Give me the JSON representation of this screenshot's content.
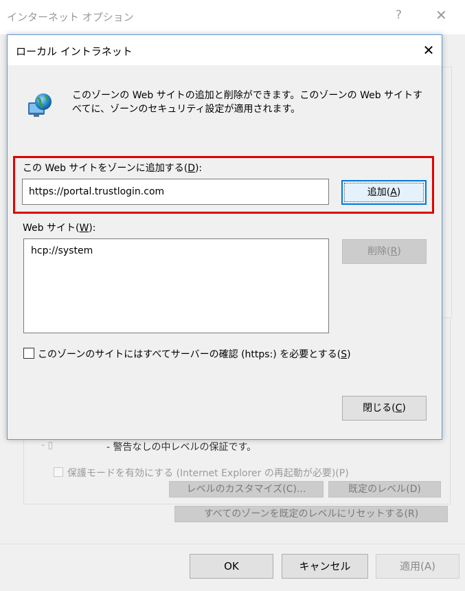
{
  "background_window": {
    "title": "インターネット オプション",
    "help_glyph": "?",
    "close_glyph": "✕",
    "security_level_mark": "- ▯",
    "security_level_text": "- 警告なしの中レベルの保証です。",
    "protected_mode_label": "保護モードを有効にする (Internet Explorer の再起動が必要)(P)",
    "custom_level_button": "レベルのカスタマイズ(C)...",
    "default_level_button": "既定のレベル(D)",
    "reset_all_button": "すべてのゾーンを既定のレベルにリセットする(R)",
    "ok_button": "OK",
    "cancel_button": "キャンセル",
    "apply_button": "適用(A)"
  },
  "dialog": {
    "title": "ローカル イントラネット",
    "close_glyph": "✕",
    "icon": "globe-monitor-icon",
    "info_text": "このゾーンの Web サイトの追加と削除ができます。このゾーンの Web サイトすべてに、ゾーンのセキュリティ設定が適用されます。",
    "add_label_prefix": "この Web サイトをゾーンに追加する(",
    "add_label_key": "D",
    "add_label_suffix": "):",
    "url_value": "https://portal.trustlogin.com",
    "add_button_prefix": "追加(",
    "add_button_key": "A",
    "add_button_suffix": ")",
    "websites_label_prefix": "Web サイト(",
    "websites_label_key": "W",
    "websites_label_suffix": "):",
    "websites": [
      "hcp://system"
    ],
    "remove_button_prefix": "削除(",
    "remove_button_key": "R",
    "remove_button_suffix": ")",
    "https_checkbox_checked": false,
    "https_label_prefix": "このゾーンのサイトにはすべてサーバーの確認 (https:) を必要とする(",
    "https_label_key": "S",
    "https_label_suffix": ")",
    "close_button_prefix": "閉じる(",
    "close_button_key": "C",
    "close_button_suffix": ")"
  },
  "colors": {
    "highlight": "#e00000",
    "focus_border": "#0078d7",
    "dialog_border": "#5b9bd5"
  }
}
